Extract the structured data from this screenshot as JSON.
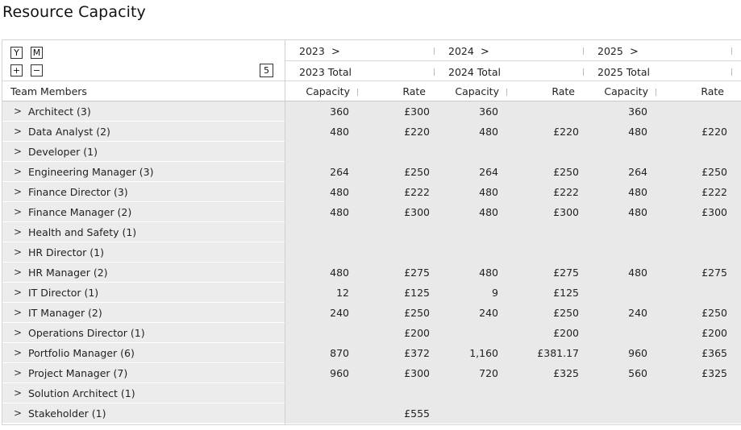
{
  "title": "Resource Capacity",
  "controls": {
    "year_btn": "Y",
    "month_btn": "M",
    "expand_btn": "+",
    "collapse_btn": "−",
    "level": "5"
  },
  "years": [
    {
      "label": "2023",
      "total": "2023 Total"
    },
    {
      "label": "2024",
      "total": "2024 Total"
    },
    {
      "label": "2025",
      "total": "2025 Total"
    }
  ],
  "chevron": ">",
  "row_header": "Team Members",
  "measures": [
    "Capacity",
    "Rate"
  ],
  "rows": [
    {
      "label": "Architect (3)",
      "cells": [
        "360",
        "£300",
        "360",
        "",
        "360",
        ""
      ]
    },
    {
      "label": "Data Analyst (2)",
      "cells": [
        "480",
        "£220",
        "480",
        "£220",
        "480",
        "£220"
      ]
    },
    {
      "label": "Developer (1)",
      "cells": [
        "",
        "",
        "",
        "",
        "",
        ""
      ]
    },
    {
      "label": "Engineering Manager (3)",
      "cells": [
        "264",
        "£250",
        "264",
        "£250",
        "264",
        "£250"
      ]
    },
    {
      "label": "Finance Director (3)",
      "cells": [
        "480",
        "£222",
        "480",
        "£222",
        "480",
        "£222"
      ]
    },
    {
      "label": "Finance Manager (2)",
      "cells": [
        "480",
        "£300",
        "480",
        "£300",
        "480",
        "£300"
      ]
    },
    {
      "label": "Health and Safety (1)",
      "cells": [
        "",
        "",
        "",
        "",
        "",
        ""
      ]
    },
    {
      "label": "HR Director (1)",
      "cells": [
        "",
        "",
        "",
        "",
        "",
        ""
      ]
    },
    {
      "label": "HR Manager (2)",
      "cells": [
        "480",
        "£275",
        "480",
        "£275",
        "480",
        "£275"
      ]
    },
    {
      "label": "IT Director (1)",
      "cells": [
        "12",
        "£125",
        "9",
        "£125",
        "",
        ""
      ]
    },
    {
      "label": "IT Manager (2)",
      "cells": [
        "240",
        "£250",
        "240",
        "£250",
        "240",
        "£250"
      ]
    },
    {
      "label": "Operations Director (1)",
      "cells": [
        "",
        "£200",
        "",
        "£200",
        "",
        "£200"
      ]
    },
    {
      "label": "Portfolio Manager (6)",
      "cells": [
        "870",
        "£372",
        "1,160",
        "£381.17",
        "960",
        "£365"
      ]
    },
    {
      "label": "Project Manager (7)",
      "cells": [
        "960",
        "£300",
        "720",
        "£325",
        "560",
        "£325"
      ]
    },
    {
      "label": "Solution Architect (1)",
      "cells": [
        "",
        "",
        "",
        "",
        "",
        ""
      ]
    },
    {
      "label": "Stakeholder (1)",
      "cells": [
        "",
        "£555",
        "",
        "",
        "",
        ""
      ]
    }
  ]
}
